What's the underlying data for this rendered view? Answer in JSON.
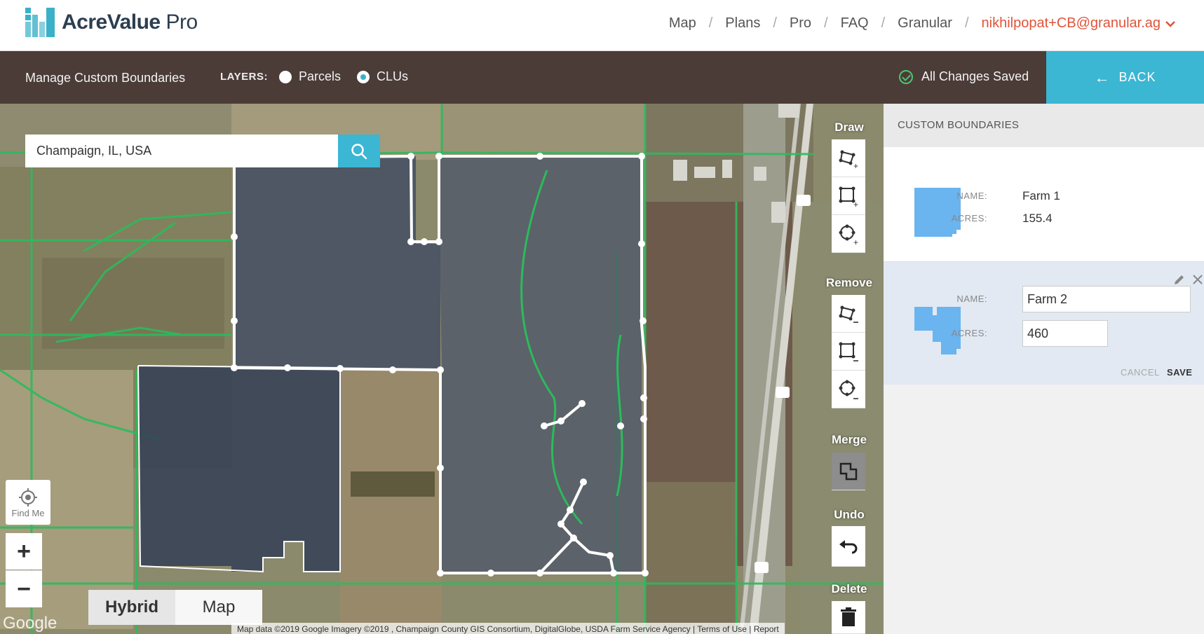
{
  "app": {
    "logo_brand": "AcreValue",
    "logo_suffix": "Pro"
  },
  "nav": {
    "links": [
      "Map",
      "Plans",
      "Pro",
      "FAQ",
      "Granular"
    ],
    "separator": "/",
    "user_email": "nikhilpopat+CB@granular.ag"
  },
  "toolbar": {
    "title": "Manage Custom Boundaries",
    "layers_label": "LAYERS:",
    "layer_options": [
      {
        "label": "Parcels",
        "selected": false
      },
      {
        "label": "CLUs",
        "selected": true
      }
    ],
    "status": "All Changes Saved",
    "back_label": "BACK"
  },
  "map": {
    "search_value": "Champaign, IL, USA",
    "find_me_label": "Find Me",
    "zoom_in": "+",
    "zoom_out": "−",
    "map_types": [
      "Hybrid",
      "Map"
    ],
    "active_map_type": "Hybrid",
    "google_label": "Google",
    "attribution": "Map data ©2019 Google Imagery ©2019 , Champaign County GIS Consortium, DigitalGlobe, USDA Farm Service Agency | Terms of Use | Report"
  },
  "tools": {
    "draw_label": "Draw",
    "remove_label": "Remove",
    "merge_label": "Merge",
    "undo_label": "Undo",
    "delete_label": "Delete",
    "draw_icons": [
      "draw-polygon-icon",
      "draw-rectangle-icon",
      "draw-circle-icon"
    ],
    "remove_icons": [
      "remove-polygon-icon",
      "remove-rectangle-icon",
      "remove-circle-icon"
    ]
  },
  "panel": {
    "header": "CUSTOM BOUNDARIES",
    "boundaries": [
      {
        "name_label": "NAME:",
        "name": "Farm 1",
        "acres_label": "ACRES:",
        "acres": "155.4"
      },
      {
        "name_label": "NAME:",
        "name": "Farm 2",
        "acres_label": "ACRES:",
        "acres": "460",
        "editing": true
      }
    ],
    "cancel_label": "CANCEL",
    "save_label": "SAVE"
  },
  "colors": {
    "accent": "#3bb6d3",
    "toolbar_bg": "#4b3c37",
    "user_link": "#e0543a",
    "shape_fill": "#6ab4ef"
  }
}
